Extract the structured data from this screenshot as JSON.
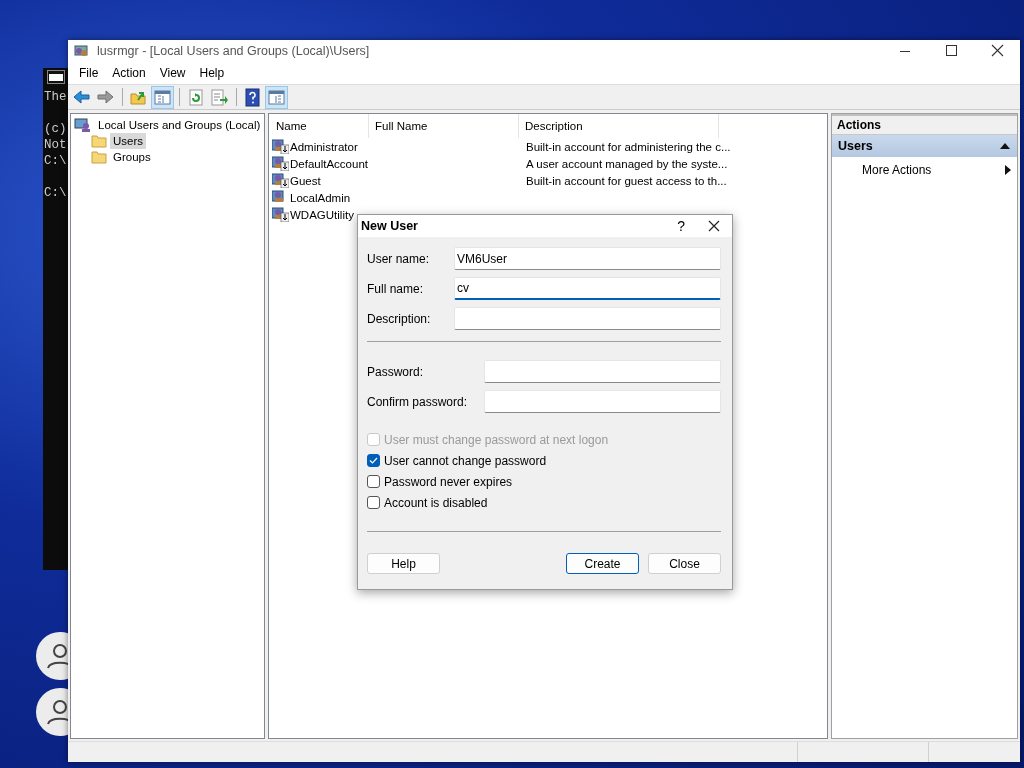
{
  "console": {
    "blocks": [
      [
        "The"
      ],
      [
        "(c)",
        "Not",
        "C:\\"
      ],
      [
        "C:\\"
      ]
    ]
  },
  "window": {
    "title": "lusrmgr - [Local Users and Groups (Local)\\Users]"
  },
  "menu": [
    "File",
    "Action",
    "View",
    "Help"
  ],
  "toolbar": [
    [
      {
        "kind": "back",
        "on": false
      },
      {
        "kind": "forward",
        "on": false
      }
    ],
    [
      {
        "kind": "up",
        "on": false
      },
      {
        "kind": "tree",
        "on": true
      }
    ],
    [
      {
        "kind": "refresh",
        "on": false
      },
      {
        "kind": "export",
        "on": false
      }
    ],
    [
      {
        "kind": "help",
        "on": false
      },
      {
        "kind": "actionpane",
        "on": true
      }
    ]
  ],
  "tree": {
    "label": "Local Users and Groups (Local)",
    "children": [
      {
        "label": "Users",
        "selected": true
      },
      {
        "label": "Groups",
        "selected": false
      }
    ]
  },
  "table": {
    "columns": [
      "Name",
      "Full Name",
      "Description"
    ],
    "rows": [
      {
        "name": "Administrator",
        "disabled": true,
        "description": "Built-in account for administering the c..."
      },
      {
        "name": "DefaultAccount",
        "disabled": true,
        "description": "A user account managed by the syste..."
      },
      {
        "name": "Guest",
        "disabled": true,
        "description": "Built-in account for guest access to th..."
      },
      {
        "name": "LocalAdmin",
        "disabled": false
      },
      {
        "name": "WDAGUtility",
        "disabled": true
      }
    ]
  },
  "actions": {
    "title": "Actions",
    "sections": [
      {
        "label": "Users",
        "expanded": true,
        "items": [
          "More Actions"
        ]
      }
    ]
  },
  "dialog": {
    "title": "New User",
    "help_glyph": "?",
    "field_groups": [
      [
        {
          "label": "User name:",
          "value": "VM6User",
          "focused": false
        },
        {
          "label": "Full name:",
          "value": "cv",
          "focused": true
        },
        {
          "label": "Description:",
          "focused": false
        }
      ],
      [
        {
          "label": "Password:",
          "focused": false
        },
        {
          "label": "Confirm password:",
          "focused": false
        }
      ]
    ],
    "options": [
      {
        "label": "User must change password at next logon",
        "checked": false,
        "disabled": true
      },
      {
        "label": "User cannot change password",
        "checked": true,
        "disabled": false
      },
      {
        "label": "Password never expires",
        "checked": false,
        "disabled": false
      },
      {
        "label": "Account is disabled",
        "checked": false,
        "disabled": false
      }
    ],
    "left_buttons": [
      {
        "label": "Help",
        "default": false
      }
    ],
    "right_buttons": [
      {
        "label": "Create",
        "default": true
      },
      {
        "label": "Close",
        "default": false
      }
    ]
  }
}
